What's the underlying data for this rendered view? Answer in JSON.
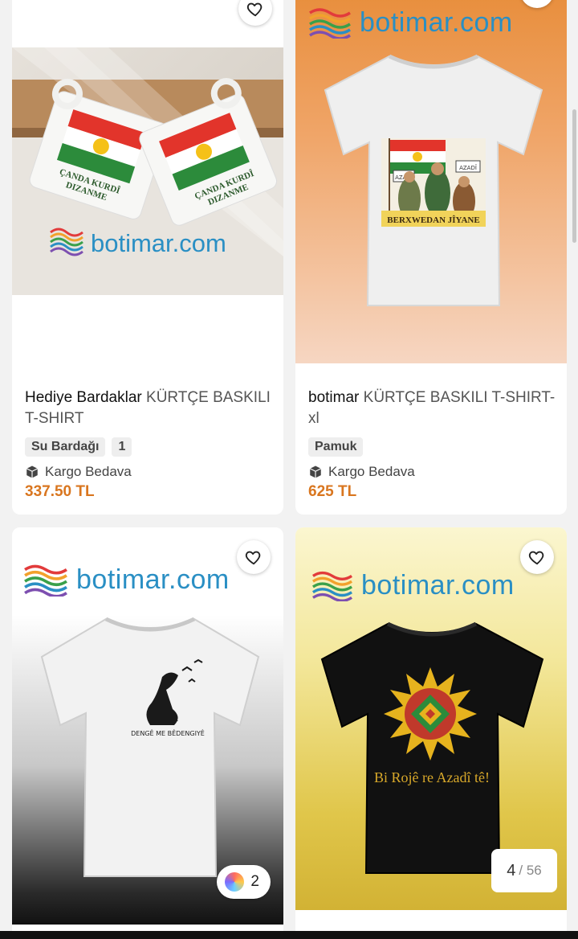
{
  "logo_text": "botimar.com",
  "products": [
    {
      "title_brand": "Hediye Bardaklar",
      "title_rest": "KÜRTÇE BASKILI T-SHIRT",
      "chips": [
        "Su Bardağı",
        "1"
      ],
      "cargo": "Kargo Bedava",
      "price": "337.50 TL",
      "mug_texts": [
        "ÇANDA KURDÎ DIZANME",
        "ÇANDA KURDÎ DIZANME"
      ]
    },
    {
      "title_brand": "botimar",
      "title_rest": "KÜRTÇE BASKILI T-SHIRT-xl",
      "chips": [
        "Pamuk"
      ],
      "cargo": "Kargo Bedava",
      "price": "625 TL",
      "print_text": "BERXWEDAN JÎYANE",
      "sign_texts": [
        "AZADÎ",
        "AZADÎ"
      ]
    },
    {
      "print_text": "DENGÊ ME BÊDENGIYÊ",
      "color_count": "2"
    },
    {
      "print_text": "Bi Rojê re Azadî tê!",
      "page_current": "4",
      "page_total": "/ 56"
    }
  ],
  "colors": {
    "price": "#d9761f",
    "logo": "#2a8fc4"
  },
  "icons": [
    "heart-icon",
    "box-icon",
    "botimar-logo-icon"
  ]
}
